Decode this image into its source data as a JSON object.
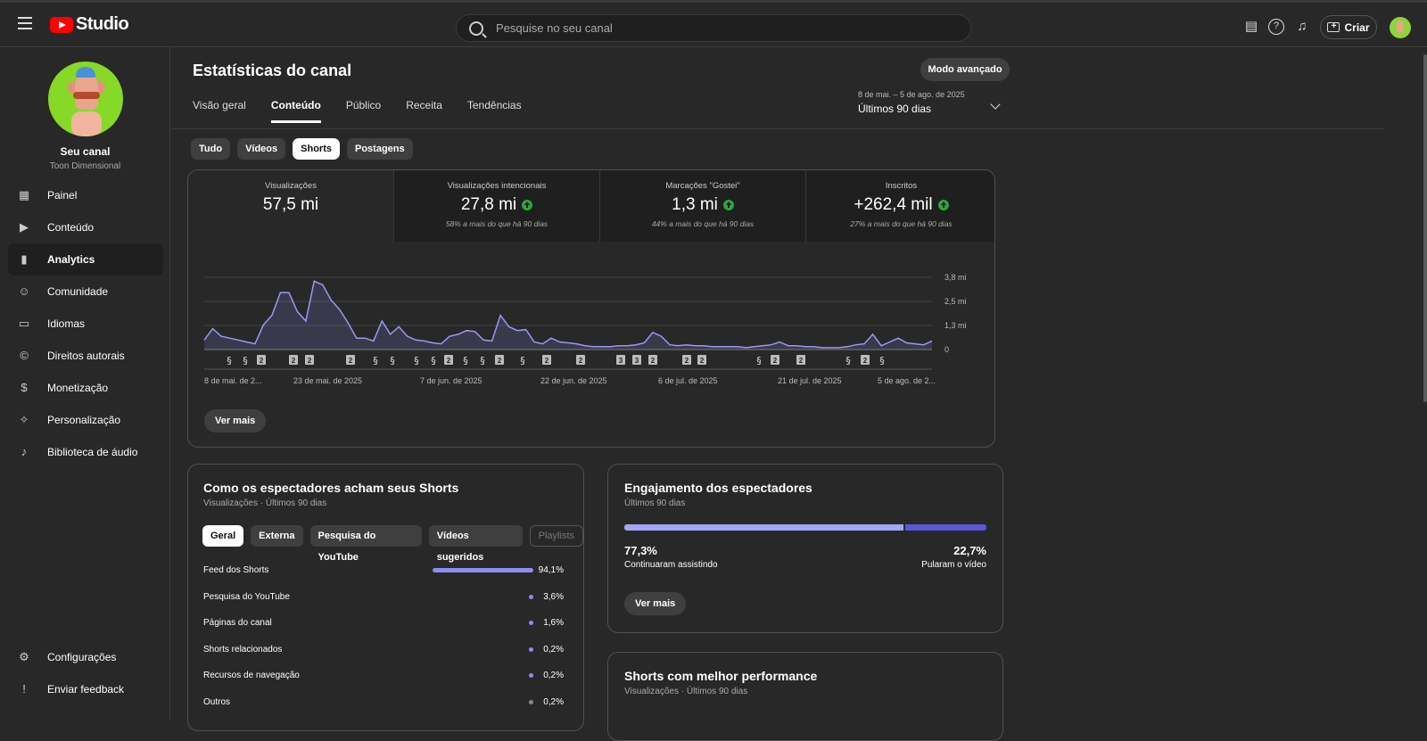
{
  "topbar": {
    "logo_text": "Studio",
    "search_placeholder": "Pesquise no seu canal",
    "create_label": "Criar",
    "icons": [
      "menu-icon",
      "captions-icon",
      "help-icon",
      "notifications-icon",
      "create-icon"
    ]
  },
  "sidebar": {
    "channel_name": "Seu canal",
    "channel_handle": "Toon Dimensional",
    "items": [
      {
        "label": "Painel",
        "icon": "dashboard-icon"
      },
      {
        "label": "Conteúdo",
        "icon": "content-icon"
      },
      {
        "label": "Analytics",
        "icon": "analytics-icon",
        "active": true
      },
      {
        "label": "Comunidade",
        "icon": "community-icon"
      },
      {
        "label": "Idiomas",
        "icon": "subtitles-icon"
      },
      {
        "label": "Direitos autorais",
        "icon": "copyright-icon"
      },
      {
        "label": "Monetização",
        "icon": "dollar-icon"
      },
      {
        "label": "Personalização",
        "icon": "magic-wand-icon"
      },
      {
        "label": "Biblioteca de áudio",
        "icon": "audio-library-icon"
      }
    ],
    "bottom_items": [
      {
        "label": "Configurações",
        "icon": "settings-icon"
      },
      {
        "label": "Enviar feedback",
        "icon": "feedback-icon"
      }
    ]
  },
  "header": {
    "title": "Estatísticas do canal",
    "advanced_mode": "Modo avançado",
    "tabs": [
      "Visão geral",
      "Conteúdo",
      "Público",
      "Receita",
      "Tendências"
    ],
    "active_tab": "Conteúdo",
    "date_range_dates": "8 de mai. – 5 de ago. de 2025",
    "date_range_label": "Últimos 90 dias"
  },
  "content_chips": [
    "Tudo",
    "Vídeos",
    "Shorts",
    "Postagens"
  ],
  "active_chip": "Shorts",
  "kpis": [
    {
      "label": "Visualizações",
      "value": "57,5 mi",
      "sub": ""
    },
    {
      "label": "Visualizações intencionais",
      "value": "27,8 mi",
      "sub": "58% a mais do que há 90 dias",
      "trend": "up"
    },
    {
      "label": "Marcações \"Gostei\"",
      "value": "1,3 mi",
      "sub": "44% a mais do que há 90 dias",
      "trend": "up"
    },
    {
      "label": "Inscritos",
      "value": "+262,4 mil",
      "sub": "27% a mais do que há 90 dias",
      "trend": "up"
    }
  ],
  "chart_data": {
    "type": "area",
    "series": [
      {
        "values": [
          0.5,
          1.1,
          0.7,
          0.6,
          0.5,
          0.4,
          0.3,
          1.3,
          1.8,
          3.0,
          3.0,
          2.0,
          1.5,
          3.6,
          3.4,
          2.6,
          2.1,
          1.4,
          0.6,
          0.6,
          0.45,
          1.5,
          0.8,
          1.2,
          0.7,
          0.5,
          0.45,
          0.35,
          0.3,
          0.7,
          0.8,
          1.0,
          0.95,
          0.5,
          0.45,
          1.8,
          1.2,
          1.0,
          1.05,
          0.4,
          0.3,
          0.6,
          0.4,
          0.35,
          0.3,
          0.2,
          0.15,
          0.15,
          0.15,
          0.2,
          0.2,
          0.25,
          0.35,
          0.9,
          0.7,
          0.25,
          0.2,
          0.25,
          0.2,
          0.2,
          0.15,
          0.15,
          0.15,
          0.15,
          0.1,
          0.15,
          0.2,
          0.25,
          0.4,
          0.2,
          0.2,
          0.15,
          0.15,
          0.1,
          0.1,
          0.1,
          0.15,
          0.25,
          0.3,
          0.8,
          0.2,
          0.4,
          0.6,
          0.35,
          0.3,
          0.25,
          0.45
        ]
      }
    ],
    "y_ticks": [
      "3,8 mi",
      "2,5 mi",
      "1,3 mi",
      "0"
    ],
    "ylim": [
      0,
      3.8
    ],
    "x_labels": [
      "8 de mai. de 2...",
      "23 de mai. de 2025",
      "7 de jun. de 2025",
      "22 de jun. de 2025",
      "6 de jul. de 2025",
      "21 de jul. de 2025",
      "5 de ago. de 2..."
    ],
    "markers": [
      "s",
      "s",
      "2",
      "2",
      "2",
      "2",
      "s",
      "s",
      "s",
      "s",
      "2",
      "s",
      "s",
      "2",
      "s",
      "2",
      "2",
      "3",
      "3",
      "2",
      "2",
      "2",
      "s",
      "2",
      "2",
      "s",
      "2",
      "s"
    ],
    "grid": true
  },
  "chart_more": "Ver mais",
  "discovery": {
    "title": "Como os espectadores acham seus Shorts",
    "subtitle": "Visualizações · Últimos 90 dias",
    "chips": [
      "Geral",
      "Externa",
      "Pesquisa do YouTube",
      "Vídeos sugeridos",
      "Playlists"
    ],
    "rows": [
      {
        "label": "Feed dos Shorts",
        "pct": "94,1%",
        "value": 94.1
      },
      {
        "label": "Pesquisa do YouTube",
        "pct": "3,6%",
        "value": 3.6
      },
      {
        "label": "Páginas do canal",
        "pct": "1,6%",
        "value": 1.6
      },
      {
        "label": "Shorts relacionados",
        "pct": "0,2%",
        "value": 0.2
      },
      {
        "label": "Recursos de navegação",
        "pct": "0,2%",
        "value": 0.2
      },
      {
        "label": "Outros",
        "pct": "0,2%",
        "value": 0.2
      }
    ]
  },
  "engagement": {
    "title": "Engajamento dos espectadores",
    "subtitle": "Últimos 90 dias",
    "kept_pct": "77,3%",
    "kept_label": "Continuaram assistindo",
    "kept_value": 77.3,
    "skipped_pct": "22,7%",
    "skipped_label": "Pularam o vídeo",
    "more": "Ver mais"
  },
  "top_shorts": {
    "title": "Shorts com melhor performance",
    "subtitle": "Visualizações · Últimos 90 dias"
  },
  "colors": {
    "accent": "#8e8cf0",
    "up": "#2ba640",
    "engaged": "#a6a4f5",
    "skipped": "#5b57d6"
  }
}
